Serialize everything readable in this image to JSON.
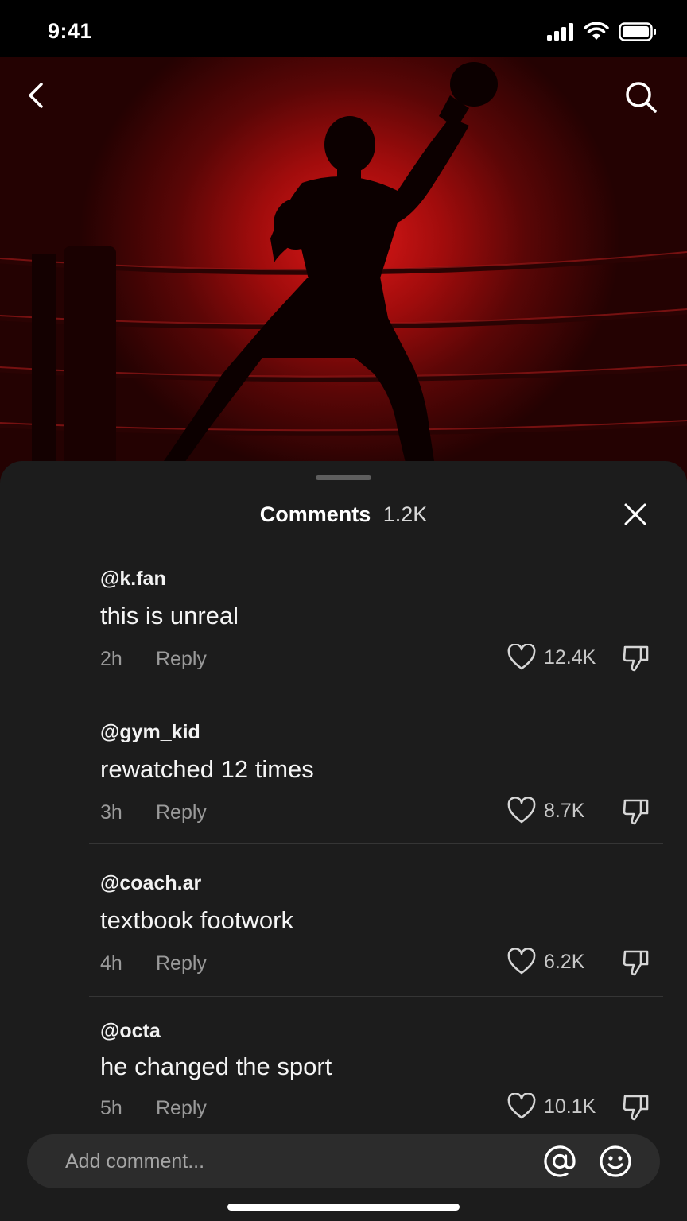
{
  "status_bar": {
    "time": "9:41"
  },
  "nav": {
    "back_icon": "chevron-left-icon",
    "search_icon": "search-icon"
  },
  "sheet": {
    "title": "Comments",
    "count": "1.2K",
    "close_icon": "close-icon"
  },
  "comments": [
    {
      "user": "@k.fan",
      "text": "this is unreal",
      "time": "2h",
      "reply": "Reply",
      "likes": "12.4K"
    },
    {
      "user": "@gym_kid",
      "text": "rewatched 12 times",
      "time": "3h",
      "reply": "Reply",
      "likes": "8.7K"
    },
    {
      "user": "@coach.ar",
      "text": "textbook footwork",
      "time": "4h",
      "reply": "Reply",
      "likes": "6.2K"
    },
    {
      "user": "@octa",
      "text": "he changed the sport",
      "time": "5h",
      "reply": "Reply",
      "likes": "10.1K"
    }
  ],
  "composer": {
    "placeholder": "Add comment...",
    "value": ""
  },
  "colors": {
    "sheet_bg": "#1c1c1c",
    "accent_red": "#e01818",
    "muted_text": "#9a9a9a"
  }
}
